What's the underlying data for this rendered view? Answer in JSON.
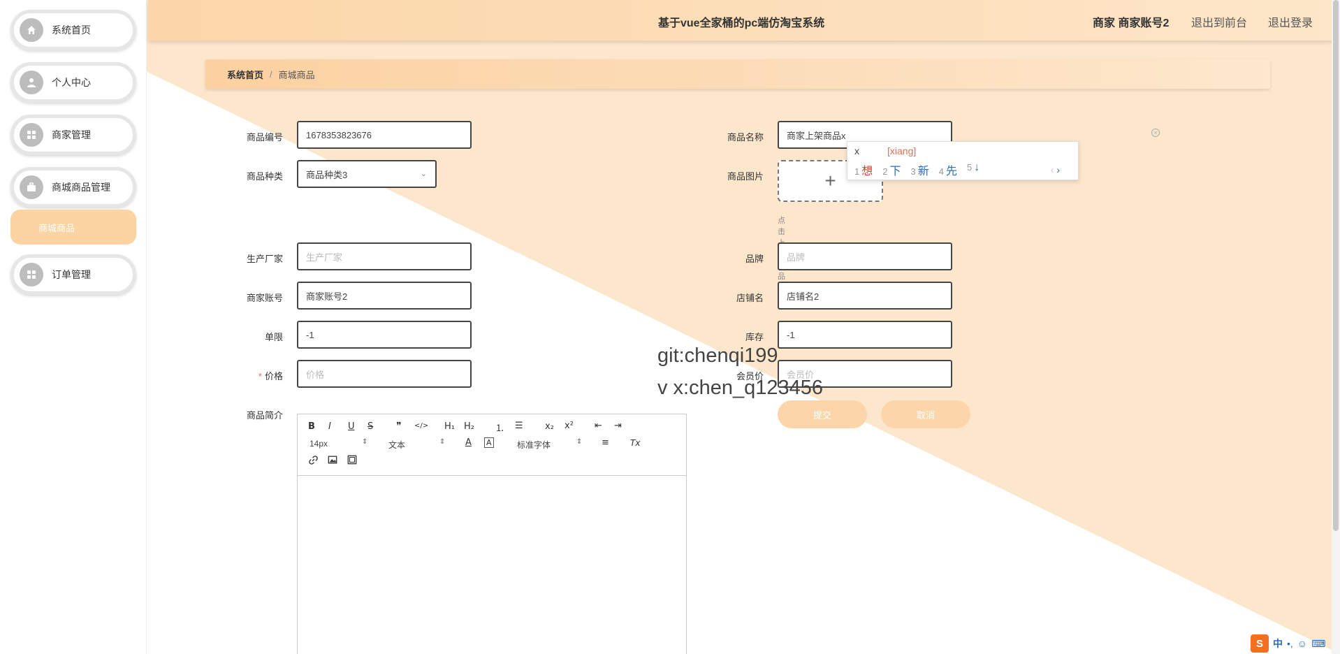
{
  "header": {
    "title": "基于vue全家桶的pc端仿淘宝系统",
    "user": "商家 商家账号2",
    "to_front": "退出到前台",
    "logout": "退出登录"
  },
  "sidebar": {
    "items": [
      {
        "label": "系统首页",
        "icon": "home-icon"
      },
      {
        "label": "个人中心",
        "icon": "user-icon"
      },
      {
        "label": "商家管理",
        "icon": "grid-icon"
      },
      {
        "label": "商城商品管理",
        "icon": "briefcase-icon"
      },
      {
        "label": "订单管理",
        "icon": "grid-icon"
      }
    ],
    "active_sub": "商城商品"
  },
  "breadcrumb": {
    "home": "系统首页",
    "sep": "/",
    "current": "商城商品"
  },
  "form": {
    "code": {
      "label": "商品编号",
      "value": "1678353823676"
    },
    "name": {
      "label": "商品名称",
      "value": "商家上架商品x"
    },
    "category": {
      "label": "商品种类",
      "value": "商品种类3"
    },
    "image": {
      "label": "商品图片",
      "tip": "点击上传商品图片",
      "plus": "+"
    },
    "maker": {
      "label": "生产厂家",
      "placeholder": "生产厂家"
    },
    "brand": {
      "label": "品牌",
      "placeholder": "品牌"
    },
    "account": {
      "label": "商家账号",
      "value": "商家账号2"
    },
    "shop": {
      "label": "店铺名",
      "value": "店铺名2"
    },
    "limit": {
      "label": "单限",
      "value": "-1"
    },
    "stock": {
      "label": "库存",
      "value": "-1"
    },
    "price": {
      "label": "价格",
      "placeholder": "价格",
      "required": "*"
    },
    "member_price": {
      "label": "会员价",
      "placeholder": "会员价"
    },
    "intro": {
      "label": "商品简介"
    }
  },
  "buttons": {
    "submit": "提交",
    "cancel": "取消"
  },
  "editor": {
    "font_size": "14px",
    "paragraph": "文本",
    "font_family": "标准字体",
    "tools": {
      "bold": "B",
      "italic": "I",
      "underline": "U",
      "strike": "S",
      "quote": "❞",
      "code": "</>",
      "h1": "H₁",
      "h2": "H₂",
      "ordered_list": "⒈",
      "bullet_list": "☰",
      "sub": "x₂",
      "sup": "x²",
      "outdent": "⇤",
      "indent": "⇥",
      "align": "≡",
      "clear": "Tx"
    }
  },
  "watermark": {
    "line1": "git:chenqi199",
    "line2": "v x:chen_q123456"
  },
  "ime": {
    "composition": "x",
    "pinyin": "[xiang]",
    "candidates": [
      {
        "n": "1",
        "text": "想"
      },
      {
        "n": "2",
        "text": "下"
      },
      {
        "n": "3",
        "text": "新"
      },
      {
        "n": "4",
        "text": "先"
      },
      {
        "n": "5",
        "text": "↓"
      }
    ],
    "prev": "‹",
    "next": "›"
  },
  "tray": {
    "logo": "S",
    "lang": "中",
    "punct": "•,",
    "emoji": "☺",
    "keyboard": "⌨"
  },
  "colors": {
    "accent": "#fcd6aa",
    "active_sub": "#fcd3a3",
    "bg_diagonal": "#fde7cc"
  }
}
